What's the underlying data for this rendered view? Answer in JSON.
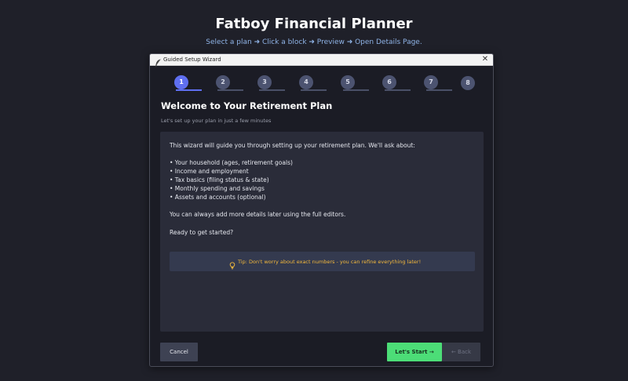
{
  "app": {
    "title": "Fatboy Financial Planner",
    "subtitle": "Select a plan ➜ Click a block ➜ Preview ➜ Open Details Page."
  },
  "dialog": {
    "title": "Guided Setup Wizard",
    "close_glyph": "✕",
    "current_step": 1,
    "steps": [
      "1",
      "2",
      "3",
      "4",
      "5",
      "6",
      "7",
      "8"
    ],
    "heading": "Welcome to Your Retirement Plan",
    "subheading": "Let's set up your plan in just a few minutes",
    "intro": "This wizard will guide you through setting up your retirement plan. We'll ask about:",
    "topics": [
      "• Your household (ages, retirement goals)",
      "• Income and employment",
      "• Tax basics (filing status & state)",
      "• Monthly spending and savings",
      "• Assets and accounts (optional)"
    ],
    "note": "You can always add more details later using the full editors.",
    "ready": "Ready to get started?",
    "tip": "Tip: Don't worry about exact numbers - you can refine everything later!",
    "buttons": {
      "cancel": "Cancel",
      "start": "Let's Start →",
      "back": "← Back"
    }
  },
  "colors": {
    "background": "#1f2029",
    "accent": "#5f6ff0",
    "start_button": "#4cdd77",
    "tip_text": "#f2b83c"
  }
}
